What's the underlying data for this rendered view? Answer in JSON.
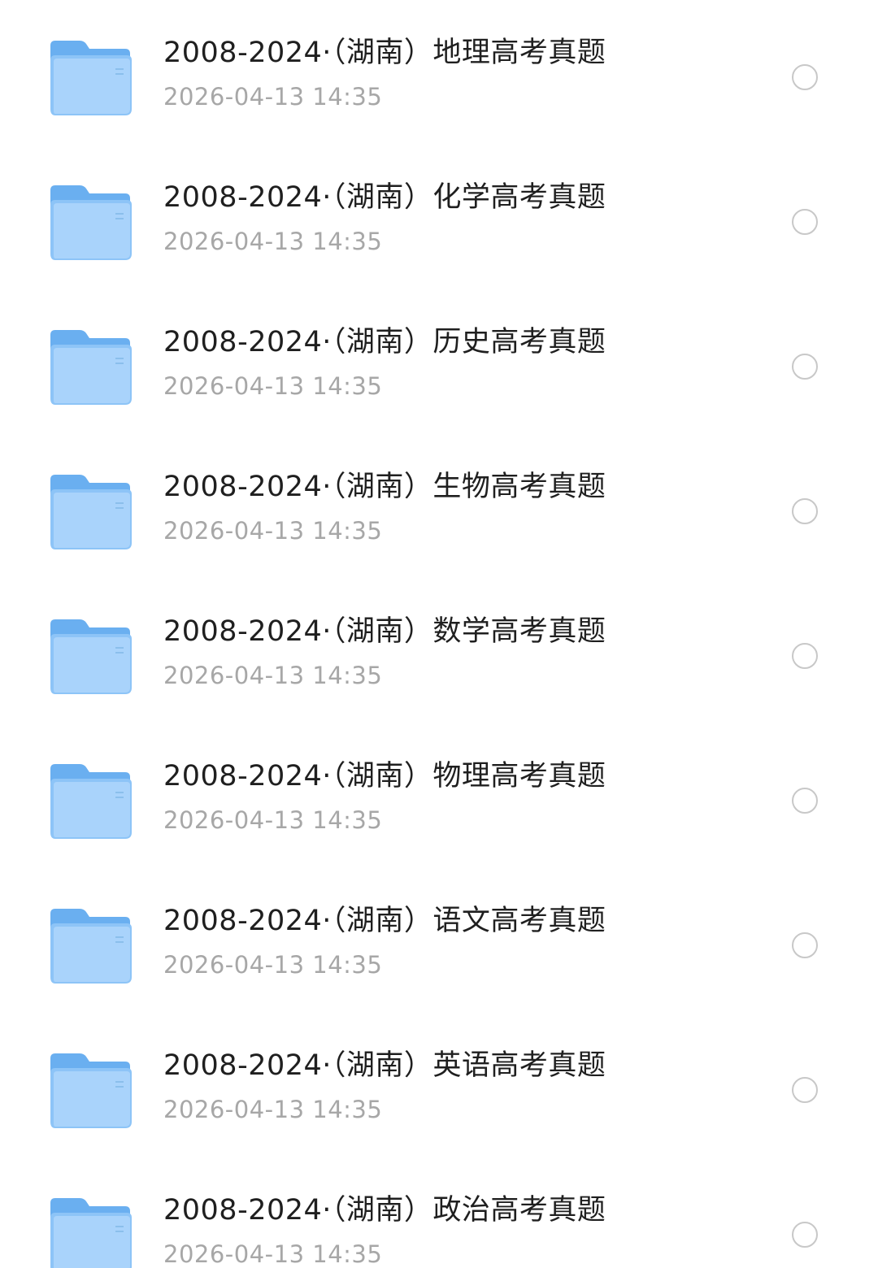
{
  "files": [
    {
      "name": "2008-2024·（湖南）地理高考真题",
      "modified": "2026-04-13 14:35"
    },
    {
      "name": "2008-2024·（湖南）化学高考真题",
      "modified": "2026-04-13 14:35"
    },
    {
      "name": "2008-2024·（湖南）历史高考真题",
      "modified": "2026-04-13 14:35"
    },
    {
      "name": "2008-2024·（湖南）生物高考真题",
      "modified": "2026-04-13 14:35"
    },
    {
      "name": "2008-2024·（湖南）数学高考真题",
      "modified": "2026-04-13 14:35"
    },
    {
      "name": "2008-2024·（湖南）物理高考真题",
      "modified": "2026-04-13 14:35"
    },
    {
      "name": "2008-2024·（湖南）语文高考真题",
      "modified": "2026-04-13 14:35"
    },
    {
      "name": "2008-2024·（湖南）英语高考真题",
      "modified": "2026-04-13 14:35"
    },
    {
      "name": "2008-2024·（湖南）政治高考真题",
      "modified": "2026-04-13 14:35"
    }
  ],
  "icons": {
    "folder": "folder-icon",
    "select": "radio-unchecked-icon"
  },
  "colors": {
    "folder_back": "#6aaff0",
    "folder_front": "#a9d3fb",
    "title_text": "#1f1f1f",
    "date_text": "#a7a7a7",
    "radio_border": "#c8c8c8"
  }
}
